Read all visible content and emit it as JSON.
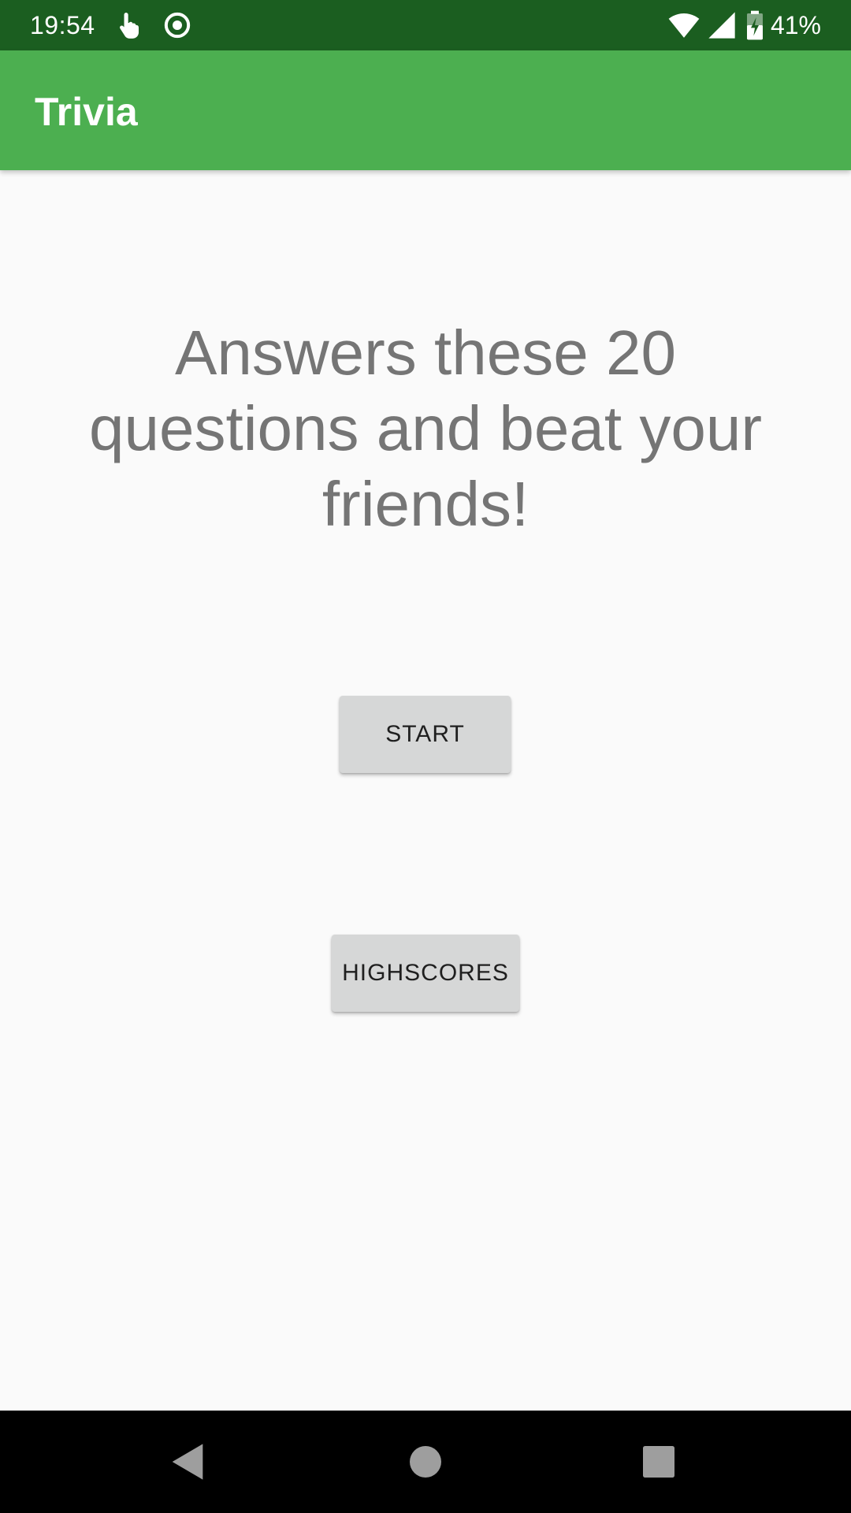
{
  "status_bar": {
    "time": "19:54",
    "battery_percent": "41%",
    "icons": [
      "touch-gesture-icon",
      "record-icon",
      "wifi-icon",
      "cellular-signal-icon",
      "battery-charging-icon"
    ],
    "background_color": "#1b5e20"
  },
  "app_bar": {
    "title": "Trivia",
    "background_color": "#4caf50"
  },
  "main": {
    "headline": "Answers these 20 questions and beat your friends!",
    "start_label": "START",
    "highscores_label": "HIGHSCORES"
  },
  "nav_bar": {
    "icons": [
      "back-icon",
      "home-icon",
      "recents-icon"
    ]
  }
}
